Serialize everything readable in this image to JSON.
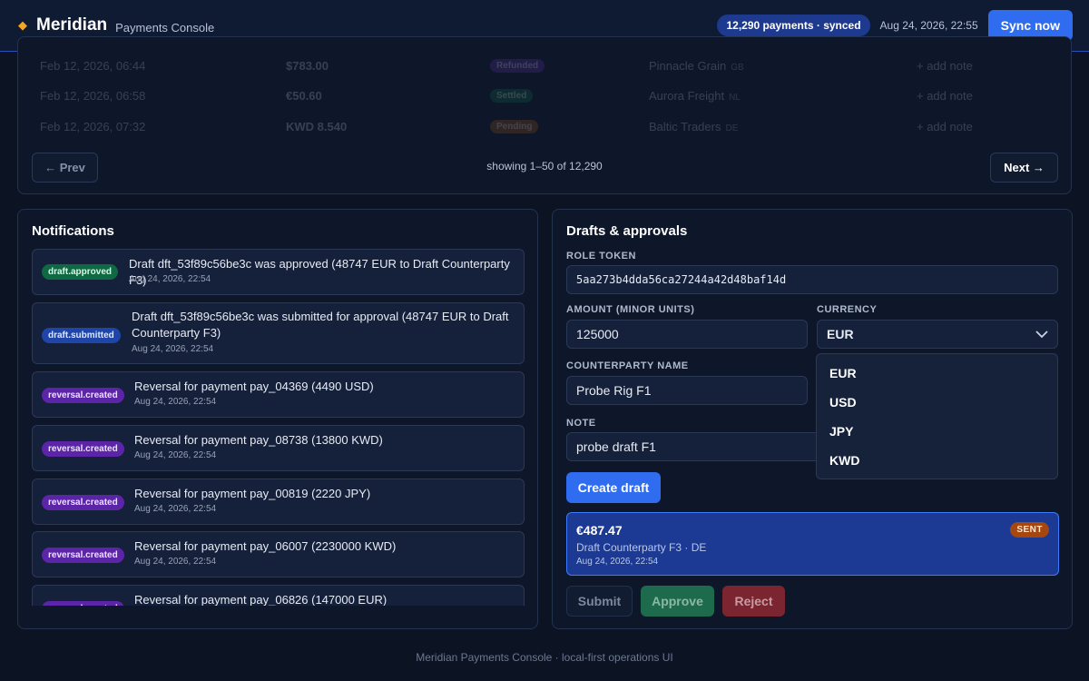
{
  "header": {
    "brand": "Meridian",
    "subtitle": "Payments Console",
    "sync_badge": "12,290 payments · synced",
    "timestamp": "Aug 24, 2026, 22:55",
    "sync_button": "Sync now"
  },
  "payments_table": {
    "rows": [
      {
        "date": "Feb 12, 2026, 06:44",
        "amount": "$783.00",
        "status": "Refunded",
        "counterparty": "Pinnacle Grain",
        "country": "GB",
        "action": "+ add note"
      },
      {
        "date": "Feb 12, 2026, 06:58",
        "amount": "€50.60",
        "status": "Settled",
        "counterparty": "Aurora Freight",
        "country": "NL",
        "action": "+ add note"
      },
      {
        "date": "Feb 12, 2026, 07:32",
        "amount": "KWD 8.540",
        "status": "Pending",
        "counterparty": "Baltic Traders",
        "country": "DE",
        "action": "+ add note"
      }
    ],
    "prev_label": "← Prev",
    "next_label": "Next →",
    "pager_info": "showing 1–50 of 12,290"
  },
  "notifications": {
    "title": "Notifications",
    "items": [
      {
        "type": "draft.approved",
        "text": "Draft dft_53f89c56be3c was approved (48747 EUR to Draft Counterparty F3)",
        "time": "Aug 24, 2026, 22:54"
      },
      {
        "type": "draft.submitted",
        "text": "Draft dft_53f89c56be3c was submitted for approval (48747 EUR to Draft Counterparty F3)",
        "time": "Aug 24, 2026, 22:54"
      },
      {
        "type": "reversal.created",
        "text": "Reversal for payment pay_04369 (4490 USD)",
        "time": "Aug 24, 2026, 22:54"
      },
      {
        "type": "reversal.created",
        "text": "Reversal for payment pay_08738 (13800 KWD)",
        "time": "Aug 24, 2026, 22:54"
      },
      {
        "type": "reversal.created",
        "text": "Reversal for payment pay_00819 (2220 JPY)",
        "time": "Aug 24, 2026, 22:54"
      },
      {
        "type": "reversal.created",
        "text": "Reversal for payment pay_06007 (2230000 KWD)",
        "time": "Aug 24, 2026, 22:54"
      },
      {
        "type": "reversal.created",
        "text": "Reversal for payment pay_06826 (147000 EUR)",
        "time": ""
      }
    ]
  },
  "drafts": {
    "title": "Drafts & approvals",
    "role_token_label": "ROLE TOKEN",
    "role_token_value": "5aa273b4dda56ca27244a42d48baf14d",
    "amount_label": "AMOUNT (MINOR UNITS)",
    "amount_value": "125000",
    "currency_label": "CURRENCY",
    "currency_value": "EUR",
    "currency_options": [
      "EUR",
      "USD",
      "JPY",
      "KWD"
    ],
    "counterparty_label": "COUNTERPARTY NAME",
    "counterparty_value": "Probe Rig F1",
    "note_label": "NOTE",
    "note_value": "probe draft F1",
    "create_button": "Create draft",
    "draft_card": {
      "amount": "€487.47",
      "subtitle": "Draft Counterparty F3 · DE",
      "time": "Aug 24, 2026, 22:54",
      "status": "SENT"
    },
    "submit_button": "Submit",
    "approve_button": "Approve",
    "reject_button": "Reject"
  },
  "footer": {
    "text": "Meridian Payments Console · local-first operations UI"
  },
  "colors": {
    "accent": "#2f6cf0",
    "background": "#0c1424",
    "panel": "#0e172a"
  }
}
